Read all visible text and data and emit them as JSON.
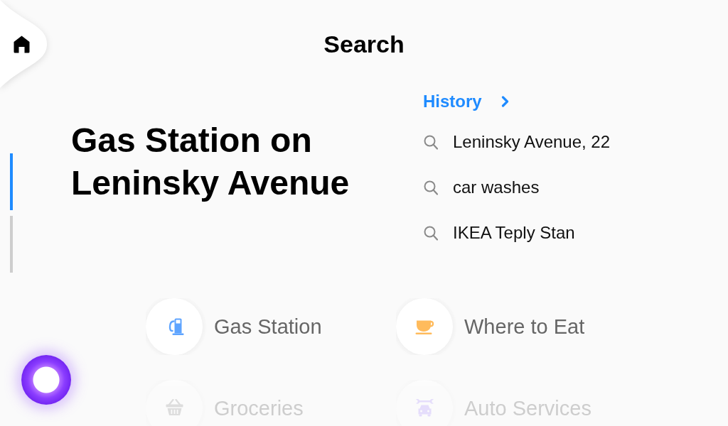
{
  "header": {
    "title": "Search"
  },
  "page_indicator": [
    {
      "selected": true
    },
    {
      "selected": false
    }
  ],
  "heading": "Gas Station on Leninsky Avenue",
  "history": {
    "title": "History",
    "items": [
      "Leninsky Avenue, 22",
      "car washes",
      "IKEA Teply Stan"
    ]
  },
  "categories": [
    {
      "label": "Gas Station"
    },
    {
      "label": "Where to Eat"
    },
    {
      "label": "Groceries"
    },
    {
      "label": "Auto Services"
    }
  ]
}
